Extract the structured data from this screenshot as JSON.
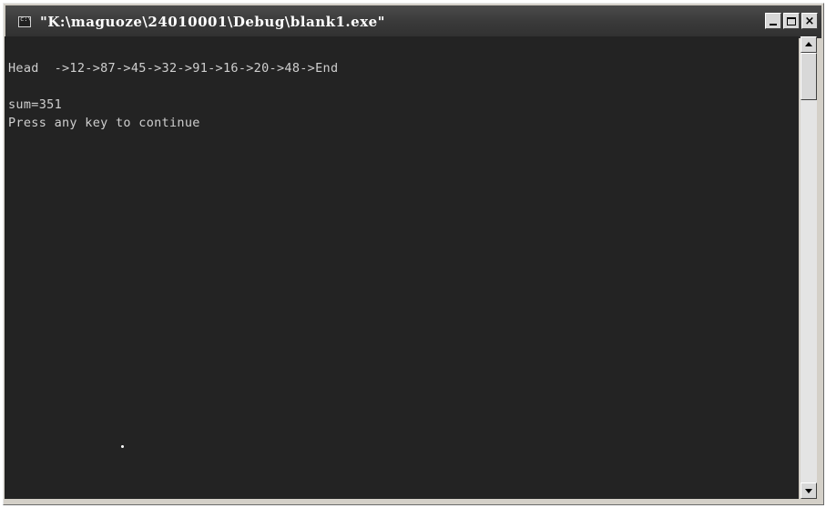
{
  "window": {
    "title": "\"K:\\maguoze\\24010001\\Debug\\blank1.exe\"",
    "icon": "console-icon",
    "controls": {
      "minimize_icon": "minimize-icon",
      "maximize_icon": "maximize-icon",
      "close_label": "×"
    }
  },
  "console": {
    "lines": [
      "Head  ->12->87->45->32->91->16->20->48->End",
      "sum=351",
      "Press any key to continue"
    ],
    "background": "#232323",
    "text_color": "#cfcfcf"
  },
  "scrollbar": {
    "up_icon": "arrow-up-icon",
    "down_icon": "arrow-down-icon"
  }
}
